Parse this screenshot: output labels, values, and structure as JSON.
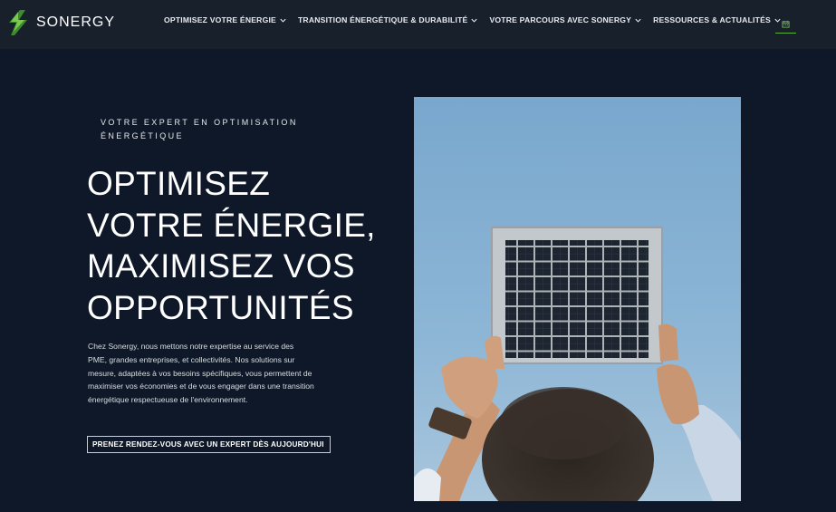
{
  "brand": {
    "name": "SONERGY",
    "logo_icon": "lightning-bolt-logo",
    "accent_color": "#5fb13f"
  },
  "nav": {
    "items": [
      {
        "label": "OPTIMISEZ VOTRE ÉNERGIE",
        "icon": "chevron-down-icon"
      },
      {
        "label": "TRANSITION ÉNERGÉTIQUE & DURABILITÉ",
        "icon": "chevron-down-icon"
      },
      {
        "label": "VOTRE PARCOURS AVEC SONERGY",
        "icon": "chevron-down-icon"
      },
      {
        "label": "RESSOURCES & ACTUALITÉS",
        "icon": "chevron-down-icon"
      }
    ],
    "calendar_icon": "calendar-icon"
  },
  "hero": {
    "eyebrow": "VOTRE EXPERT EN OPTIMISATION ÉNERGÉTIQUE",
    "title_lines": [
      "OPTIMISEZ",
      "VOTRE ÉNERGIE,",
      "MAXIMISEZ VOS",
      "OPPORTUNITÉS"
    ],
    "description": "Chez Sonergy, nous mettons notre expertise au service des PME, grandes entreprises, et collectivités. Nos solutions sur mesure, adaptées à vos besoins spécifiques, vous permettent de maximiser vos économies et de vous engager dans une transition énergétique respectueuse de l'environnement.",
    "cta_label": "PRENEZ RENDEZ-VOUS AVEC UN EXPERT DÈS AUJOURD'HUI",
    "cta_icon": "arrow-right-icon",
    "image": "person-holding-solar-panel-photo"
  },
  "colors": {
    "background": "#0f1828",
    "header": "#18202c",
    "sky": "#7fa9cc"
  }
}
